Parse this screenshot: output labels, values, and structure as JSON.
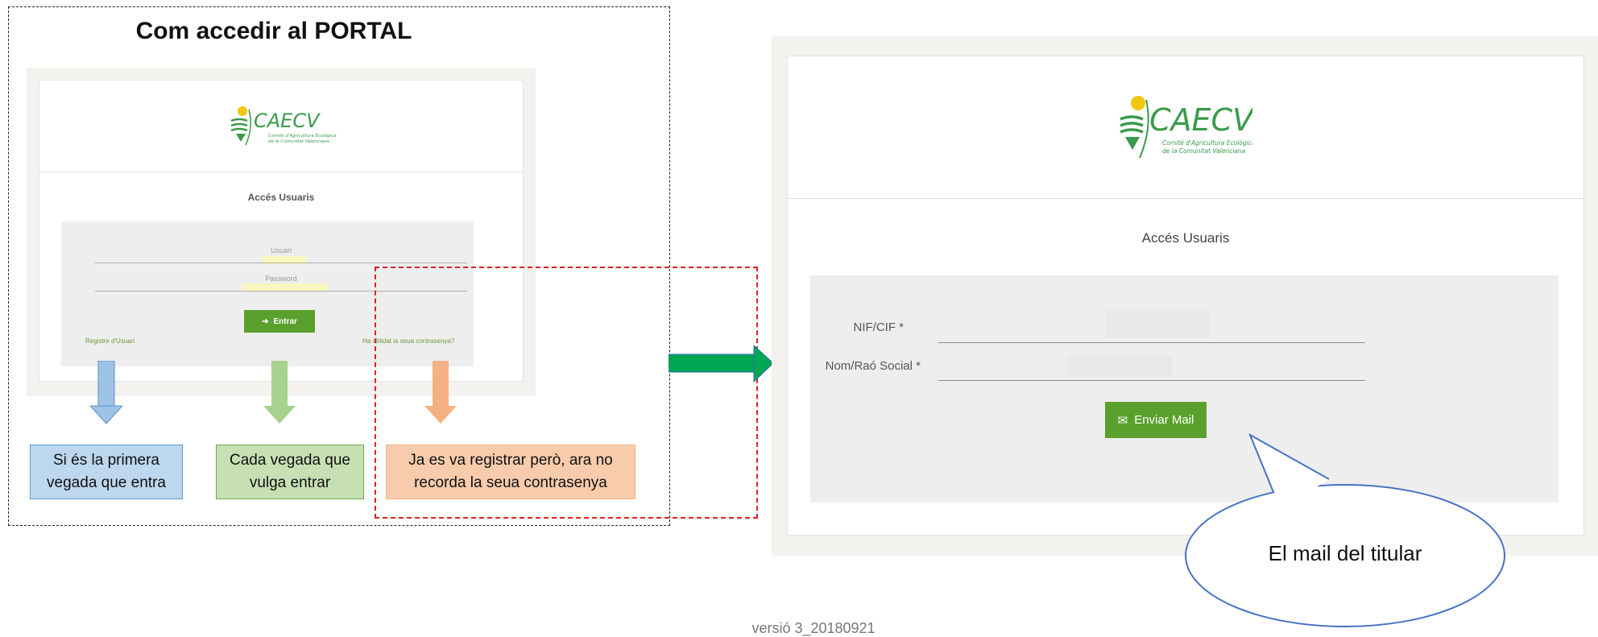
{
  "left": {
    "title": "Com accedir al PORTAL",
    "screenshot": {
      "heading": "Accés Usuaris",
      "usuari_label": "Usuari",
      "password_label": "Password",
      "button_label": "Entrar",
      "register_link": "Registre d'Usuari",
      "forgot_link": "Ha oblidat la seua contrasenya?"
    },
    "boxes": [
      {
        "text": "Si és la primera vegada que entra",
        "color": "#bdd7ee"
      },
      {
        "text": "Cada vegada que vulga entrar",
        "color": "#c6e0b4"
      },
      {
        "text": "Ja es va registrar però, ara no recorda la seua contrasenya",
        "color": "#f8cbad"
      }
    ],
    "arrow_colors": [
      "#9dc3e6",
      "#a9d18e",
      "#f4b183"
    ]
  },
  "right": {
    "heading": "Accés Usuaris",
    "fields": [
      {
        "label": "NIF/CIF *",
        "value": ""
      },
      {
        "label": "Nom/Raó Social *",
        "value": ""
      }
    ],
    "button_label": "Enviar Mail",
    "callout": "El mail del titular"
  },
  "logo": {
    "name": "CAECV",
    "line1": "Comité d'Agricultura Ecològica",
    "line2": "de la Comunitat Valenciana"
  },
  "footer": "versió 3_20180921",
  "colors": {
    "accent_green": "#5aa02c",
    "connector_arrow": "#00a651",
    "dashed_red": "#e02020",
    "callout_border": "#4472c4"
  }
}
